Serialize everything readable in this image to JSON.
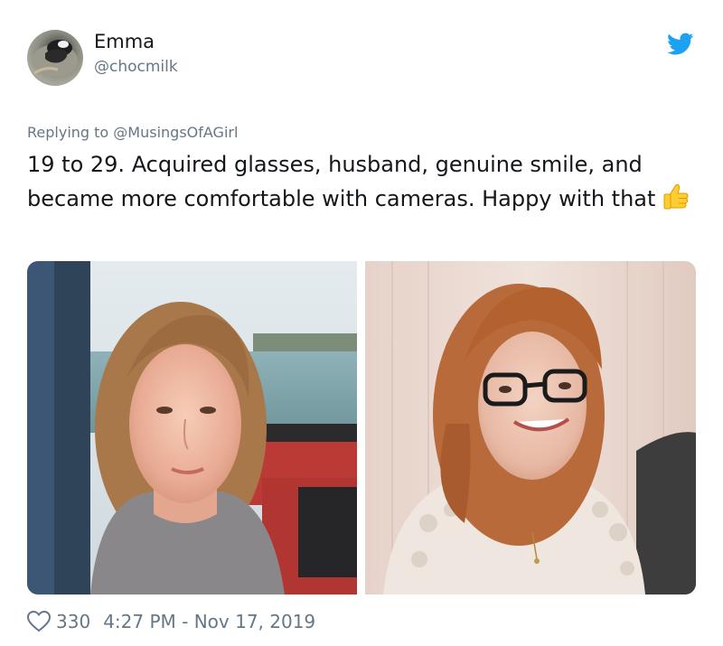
{
  "user": {
    "name": "Emma",
    "handle": "@chocmilk",
    "avatar_alt": "profile picture"
  },
  "reply": {
    "prefix": "Replying to",
    "mention": "@MusingsOfAGirl"
  },
  "tweet": {
    "text": "19 to 29. Acquired glasses, husband, genuine smile, and became more comfortable with cameras. Happy with that",
    "emoji": "thumbs-up"
  },
  "media": [
    {
      "icon": "photo-before"
    },
    {
      "icon": "photo-after"
    }
  ],
  "footer": {
    "likes": "330",
    "timestamp": "4:27 PM - Nov 17, 2019"
  },
  "colors": {
    "brand": "#1da1f2",
    "text": "#14171a",
    "muted": "#657786"
  }
}
